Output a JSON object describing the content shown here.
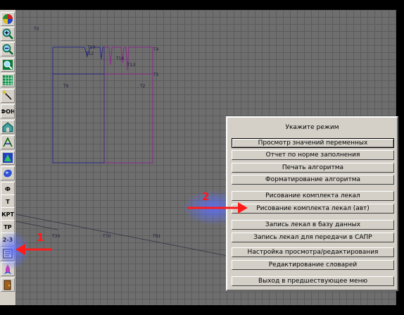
{
  "toolbar": {
    "buttons": [
      {
        "icon": "color-wheel-icon"
      },
      {
        "icon": "zoom-in-icon"
      },
      {
        "icon": "zoom-out-icon"
      },
      {
        "icon": "zoom-fit-icon"
      },
      {
        "icon": "grid-icon"
      },
      {
        "icon": "line-tool-icon"
      },
      {
        "label": "ФОН"
      },
      {
        "icon": "house-icon"
      },
      {
        "icon": "measure-icon"
      },
      {
        "icon": "pattern-icon"
      },
      {
        "icon": "eraser-icon"
      },
      {
        "label": "Ф"
      },
      {
        "label": "Т"
      },
      {
        "label": "КРТ"
      },
      {
        "label": "ТР"
      },
      {
        "label": "2-3"
      },
      {
        "icon": "report-icon"
      },
      {
        "icon": "rocket-icon"
      },
      {
        "icon": "exit-door-icon"
      }
    ]
  },
  "plot": {
    "labels": {
      "top_left": "Т0",
      "t12": "Т12",
      "t19": "Т19",
      "t16": "Т16",
      "t13": "Т13",
      "t4": "Т4",
      "t5": "Т5",
      "t9": "Т9",
      "t2": "Т2",
      "t130": "Т30",
      "t170": "Т70",
      "t190": "Т91"
    }
  },
  "dialog": {
    "title": "Укажите режим",
    "items": [
      "Просмотр значений переменных",
      "Отчет по норме заполнения",
      "Печать алгоритма",
      "Форматирование алгоритма",
      "Рисование комплекта лекал",
      "Рисование комплекта лекал (авт)",
      "Запись лекал в базу данных",
      "Запись лекал для передачи в САПР",
      "Настройка просмотра/редактирования",
      "Редактирование словарей",
      "Выход в предшествующее меню"
    ]
  },
  "annotations": {
    "marker_1": "1",
    "marker_2": "2",
    "arrow_color": "#ff1a1a",
    "glow_color": "#5a6eff"
  }
}
